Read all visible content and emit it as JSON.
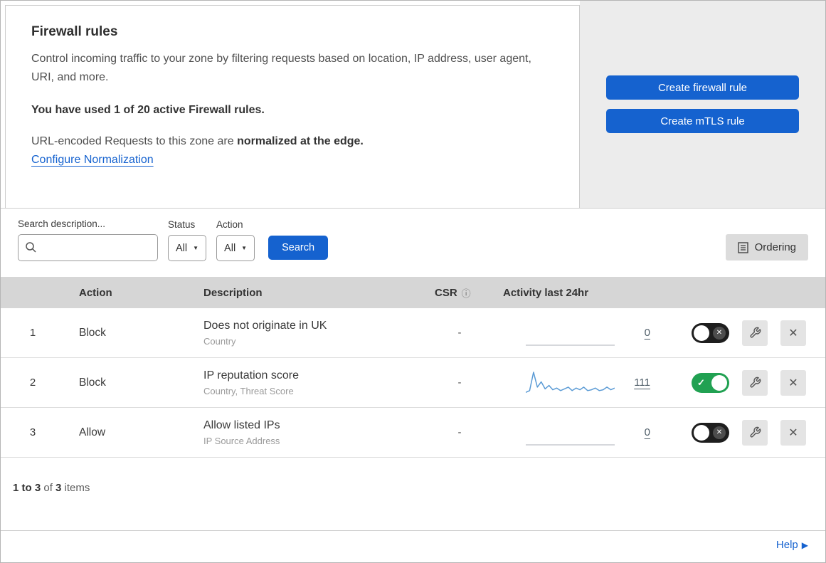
{
  "colors": {
    "accent": "#1562cf",
    "toggle_on": "#21a152",
    "sparkline": "#5b9bd5",
    "sparkline_flat": "#c9ccd1"
  },
  "overview": {
    "title": "Firewall rules",
    "description": "Control incoming traffic to your zone by filtering requests based on location, IP address, user agent, URI, and more.",
    "usage": "You have used 1 of 20 active Firewall rules.",
    "normalization_prefix": "URL-encoded Requests to this zone are ",
    "normalization_bold": "normalized at the edge.",
    "normalization_link": "Configure Normalization",
    "create_firewall_rule": "Create firewall rule",
    "create_mtls_rule": "Create mTLS rule"
  },
  "filters": {
    "search_label": "Search description...",
    "status_label": "Status",
    "status_value": "All",
    "action_label": "Action",
    "action_value": "All",
    "search_button": "Search",
    "ordering_button": "Ordering"
  },
  "table": {
    "headers": {
      "action": "Action",
      "description": "Description",
      "csr": "CSR",
      "activity": "Activity last 24hr"
    },
    "rows": [
      {
        "index": "1",
        "action": "Block",
        "description": "Does not originate in UK",
        "fields": "Country",
        "csr": "-",
        "count": "0",
        "enabled": false,
        "sparkline": [
          0,
          0,
          0,
          0,
          0,
          0,
          0,
          0,
          0,
          0,
          0,
          0,
          0,
          0,
          0,
          0,
          0,
          0,
          0,
          0,
          0,
          0,
          0,
          0
        ]
      },
      {
        "index": "2",
        "action": "Block",
        "description": "IP reputation score",
        "fields": "Country, Threat Score",
        "csr": "-",
        "count": "111",
        "enabled": true,
        "sparkline": [
          3,
          5,
          26,
          9,
          15,
          7,
          11,
          6,
          8,
          5,
          7,
          9,
          5,
          8,
          6,
          9,
          5,
          6,
          8,
          5,
          6,
          9,
          6,
          8
        ]
      },
      {
        "index": "3",
        "action": "Allow",
        "description": "Allow listed IPs",
        "fields": "IP Source Address",
        "csr": "-",
        "count": "0",
        "enabled": false,
        "sparkline": [
          0,
          0,
          0,
          0,
          0,
          0,
          0,
          0,
          0,
          0,
          0,
          0,
          0,
          0,
          0,
          0,
          0,
          0,
          0,
          0,
          0,
          0,
          0,
          0
        ]
      }
    ]
  },
  "footer": {
    "range": "1 to 3",
    "of_text": " of ",
    "total": "3",
    "items_text": " items",
    "help": "Help"
  }
}
